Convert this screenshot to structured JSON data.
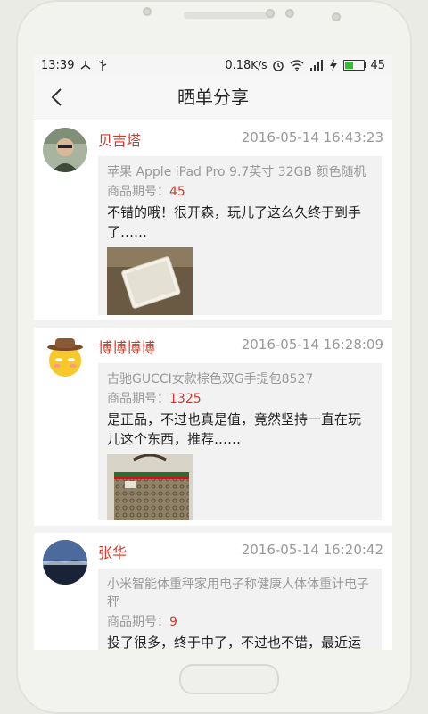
{
  "status_bar": {
    "time": "13:39",
    "speed": "0.18",
    "speed_unit": "K/s",
    "battery": "45"
  },
  "header": {
    "title": "晒单分享"
  },
  "posts": [
    {
      "username": "贝吉塔",
      "time": "2016-05-14 16:43:23",
      "product": "苹果 Apple iPad Pro 9.7英寸 32GB 颜色随机",
      "period_label": "商品期号：",
      "period": "45",
      "comment": "不错的哦！很开森，玩儿了这么久终于到手了……"
    },
    {
      "username": "博博博博",
      "time": "2016-05-14 16:28:09",
      "product": "古驰GUCCI女款棕色双G手提包8527",
      "period_label": "商品期号：",
      "period": "1325",
      "comment": "是正品，不过也真是值，竟然坚持一直在玩儿这个东西，推荐……"
    },
    {
      "username": "张华",
      "time": "2016-05-14 16:20:42",
      "product": "小米智能体重秤家用电子称健康人体体重计电子秤",
      "period_label": "商品期号：",
      "period": "9",
      "comment": "投了很多，终于中了，不过也不错，最近运气还挺好的，还中了个玩具车"
    }
  ],
  "colors": {
    "accent": "#d33a2c",
    "battery": "#2fbf2f"
  }
}
